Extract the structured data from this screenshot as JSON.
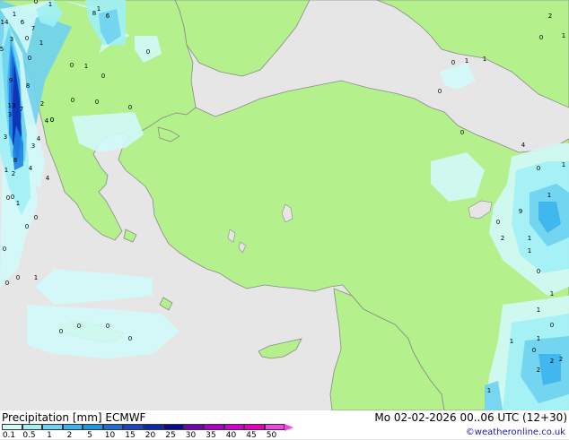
{
  "map": {
    "land_color": "#b4f08c",
    "sea_color": "#e6e6e6",
    "precip_colors": [
      "#d2fafa",
      "#a0f0f5",
      "#6ed2f0",
      "#3cb4f0",
      "#1e82e6",
      "#1e5ad2",
      "#0a32b4"
    ],
    "labels": [
      {
        "t": "14"
      },
      {
        "t": "6"
      },
      {
        "t": "1"
      },
      {
        "t": "7"
      },
      {
        "t": "0"
      },
      {
        "t": "1"
      },
      {
        "t": "6"
      },
      {
        "t": "8"
      },
      {
        "t": "3"
      },
      {
        "t": "0"
      },
      {
        "t": "1"
      },
      {
        "t": "5"
      },
      {
        "t": "9"
      },
      {
        "t": "0"
      },
      {
        "t": "8"
      },
      {
        "t": "2"
      },
      {
        "t": "4"
      },
      {
        "t": "13"
      },
      {
        "t": "3"
      },
      {
        "t": "7"
      },
      {
        "t": "4"
      },
      {
        "t": "3"
      },
      {
        "t": "8"
      },
      {
        "t": "0"
      },
      {
        "t": "3"
      },
      {
        "t": "4"
      },
      {
        "t": "4"
      },
      {
        "t": "1"
      },
      {
        "t": "2"
      },
      {
        "t": "0"
      },
      {
        "t": "0"
      },
      {
        "t": "1"
      },
      {
        "t": "0"
      },
      {
        "t": "0"
      },
      {
        "t": "0"
      },
      {
        "t": "1"
      },
      {
        "t": "0"
      },
      {
        "t": "0"
      },
      {
        "t": "0"
      },
      {
        "t": "0"
      },
      {
        "t": "0"
      },
      {
        "t": "1"
      },
      {
        "t": "0"
      },
      {
        "t": "0"
      },
      {
        "t": "0"
      },
      {
        "t": "1"
      },
      {
        "t": "0"
      },
      {
        "t": "0"
      },
      {
        "t": "0"
      },
      {
        "t": "0"
      },
      {
        "t": "0"
      },
      {
        "t": "1"
      },
      {
        "t": "0"
      },
      {
        "t": "1"
      },
      {
        "t": "0"
      },
      {
        "t": "0"
      },
      {
        "t": "2"
      },
      {
        "t": "0"
      },
      {
        "t": "1"
      },
      {
        "t": "4"
      },
      {
        "t": "0"
      },
      {
        "t": "1"
      },
      {
        "t": "1"
      },
      {
        "t": "9"
      },
      {
        "t": "1"
      },
      {
        "t": "0"
      },
      {
        "t": "2"
      },
      {
        "t": "1"
      },
      {
        "t": "0"
      },
      {
        "t": "1"
      },
      {
        "t": "1"
      },
      {
        "t": "0"
      },
      {
        "t": "1"
      },
      {
        "t": "1"
      },
      {
        "t": "0"
      },
      {
        "t": "2"
      },
      {
        "t": "2"
      },
      {
        "t": "2"
      },
      {
        "t": "1"
      }
    ]
  },
  "footer": {
    "title": "Precipitation [mm]  ECMWF",
    "datetime": "Mo 02-02-2026 00..06 UTC (12+30)",
    "credit": "©weatheronline.co.uk",
    "scale": {
      "ticks": [
        "0.1",
        "0.5",
        "1",
        "2",
        "5",
        "10",
        "15",
        "20",
        "25",
        "30",
        "35",
        "40",
        "45",
        "50"
      ],
      "colors": [
        "#d2fafa",
        "#a0f0f5",
        "#6ed2f0",
        "#3cb4f0",
        "#1e96e6",
        "#1e6ed2",
        "#1e46be",
        "#0a28aa",
        "#0a0a8c",
        "#7800b4",
        "#aa00c8",
        "#d200d2",
        "#e600be",
        "#f046e6"
      ]
    }
  }
}
